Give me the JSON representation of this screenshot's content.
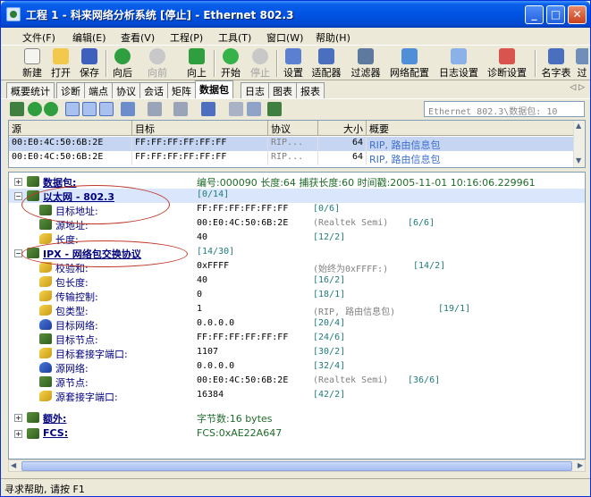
{
  "window": {
    "title": "工程 1 - 科来网络分析系统 [停止] - Ethernet 802.3",
    "btn_minimize": "_",
    "btn_maximize": "□",
    "btn_close": "✕"
  },
  "menu": [
    "文件(F)",
    "编辑(E)",
    "查看(V)",
    "工程(P)",
    "工具(T)",
    "窗口(W)",
    "帮助(H)"
  ],
  "toolbar": {
    "new": "新建",
    "open": "打开",
    "save": "保存",
    "back": "向后",
    "forward": "向前",
    "up": "向上",
    "start": "开始",
    "stop": "停止",
    "settings": "设置",
    "adapter": "适配器",
    "filter": "过滤器",
    "netconfig": "网络配置",
    "logsettings": "日志设置",
    "diagsettings": "诊断设置",
    "nametable": "名字表",
    "more": "过"
  },
  "tabs": [
    "概要统计",
    "诊断",
    "端点",
    "协议",
    "会话",
    "矩阵",
    "数据包",
    "日志",
    "图表",
    "报表"
  ],
  "tab_scroll": "◁ ▷",
  "path_box": "Ethernet 802.3\\数据包: 10",
  "packet_list": {
    "columns": [
      "源",
      "目标",
      "协议",
      "大小",
      "概要"
    ],
    "rows": [
      {
        "src": "00:E0:4C:50:6B:2E",
        "dst": "FF:FF:FF:FF:FF:FF",
        "proto": "RIP...",
        "size": "64",
        "summary": "RIP, 路由信息包"
      },
      {
        "src": "00:E0:4C:50:6B:2E",
        "dst": "FF:FF:FF:FF:FF:FF",
        "proto": "RIP...",
        "size": "64",
        "summary": "RIP, 路由信息包"
      }
    ]
  },
  "tree": {
    "packet": {
      "label": "数据包:",
      "info": "编号:000090 长度:64 捕获长度:60 时间戳:2005-11-01 10:16:06.229961"
    },
    "eth": {
      "label": "以太网 - 802.3",
      "off": "[0/14]"
    },
    "eth_fields": [
      {
        "label": "目标地址:",
        "value": "FF:FF:FF:FF:FF:FF",
        "note": "",
        "off": "[0/6]"
      },
      {
        "label": "源地址:",
        "value": "00:E0:4C:50:6B:2E",
        "note": "(Realtek Semi)",
        "off": "[6/6]"
      },
      {
        "label": "长度:",
        "value": "40",
        "note": "",
        "off": "[12/2]"
      }
    ],
    "ipx": {
      "label": "IPX - 网络包交换协议",
      "off": "[14/30]"
    },
    "ipx_fields": [
      {
        "label": "校验和:",
        "value": "0xFFFF",
        "note": "(始终为0xFFFF:)",
        "off": "[14/2]"
      },
      {
        "label": "包长度:",
        "value": "40",
        "note": "",
        "off": "[16/2]"
      },
      {
        "label": "传输控制:",
        "value": "0",
        "note": "",
        "off": "[18/1]"
      },
      {
        "label": "包类型:",
        "value": "1",
        "note": "(RIP, 路由信息包)",
        "off": "[19/1]"
      },
      {
        "label": "目标网络:",
        "value": "0.0.0.0",
        "note": "",
        "off": "[20/4]"
      },
      {
        "label": "目标节点:",
        "value": "FF:FF:FF:FF:FF:FF",
        "note": "",
        "off": "[24/6]"
      },
      {
        "label": "目标套接字端口:",
        "value": "1107",
        "note": "",
        "off": "[30/2]"
      },
      {
        "label": "源网络:",
        "value": "0.0.0.0",
        "note": "",
        "off": "[32/4]"
      },
      {
        "label": "源节点:",
        "value": "00:E0:4C:50:6B:2E",
        "note": "(Realtek Semi)",
        "off": "[36/6]"
      },
      {
        "label": "源套接字端口:",
        "value": "16384",
        "note": "",
        "off": "[42/2]"
      }
    ],
    "extra": {
      "label": "额外:",
      "info": "字节数:16 bytes"
    },
    "fcs": {
      "label": "FCS:",
      "info": "FCS:0xAE22A647"
    }
  },
  "status": "寻求帮助, 请按 F1"
}
